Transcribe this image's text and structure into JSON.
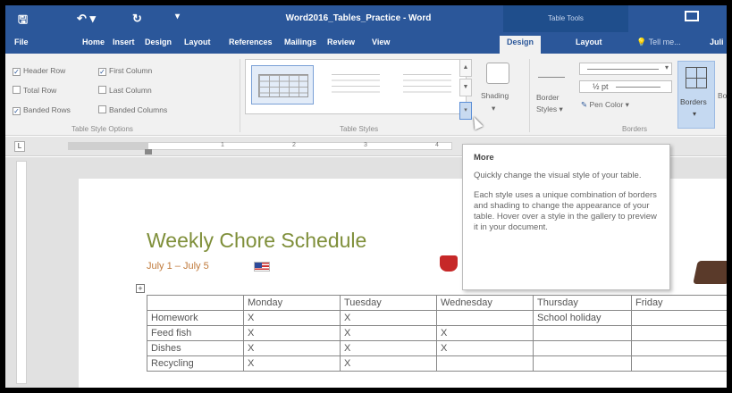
{
  "titlebar": {
    "doc_title": "Word2016_Tables_Practice - Word",
    "context_label": "Table Tools",
    "save_glyph": "🖫",
    "undo_glyph": "↶ ▾",
    "redo_glyph": "↻",
    "qa_more_glyph": "▾"
  },
  "tabs": [
    "File",
    "Home",
    "Insert",
    "Design",
    "Layout",
    "References",
    "Mailings",
    "Review",
    "View",
    "Design",
    "Layout",
    "Tell me...",
    "Juli"
  ],
  "active_tab": "Design",
  "ribbon": {
    "table_style_options": {
      "label": "Table Style Options",
      "options": [
        {
          "label": "Header Row",
          "checked": true
        },
        {
          "label": "First Column",
          "checked": true
        },
        {
          "label": "Total Row",
          "checked": false
        },
        {
          "label": "Last Column",
          "checked": false
        },
        {
          "label": "Banded Rows",
          "checked": true
        },
        {
          "label": "Banded Columns",
          "checked": false
        }
      ]
    },
    "table_styles": {
      "label": "Table Styles"
    },
    "shading_label": "Shading",
    "border_styles_label": "Border Styles",
    "border_styles_line1": "Border",
    "border_styles_line2": "Styles ▾",
    "pen_weight": "½ pt",
    "pen_color_label": "Pen Color ▾",
    "borders_label": "Borders",
    "borders_group_label": "Borders",
    "border_painter_cut": "Bo Pa"
  },
  "ruler": {
    "numbers": [
      "1",
      "2",
      "3",
      "4"
    ]
  },
  "document": {
    "heading": "Weekly Chore Schedule",
    "subtitle": "July 1 – July 5",
    "table": {
      "header": [
        "",
        "Monday",
        "Tuesday",
        "Wednesday",
        "Thursday",
        "Friday"
      ],
      "rows": [
        [
          "Homework",
          "X",
          "X",
          "",
          "School holiday",
          ""
        ],
        [
          "Feed fish",
          "X",
          "X",
          "X",
          "",
          ""
        ],
        [
          "Dishes",
          "X",
          "X",
          "X",
          "",
          ""
        ],
        [
          "Recycling",
          "X",
          "X",
          "",
          "",
          ""
        ]
      ]
    }
  },
  "tooltip": {
    "title": "More",
    "p1": "Quickly change the visual style of your table.",
    "p2": "Each style uses a unique combination of borders and shading to change the appearance of your table. Hover over a style in the gallery to preview it in your document."
  },
  "colors": {
    "accent": "#2b579a",
    "heading": "#7f8f3a",
    "subtitle": "#c07a3b"
  }
}
